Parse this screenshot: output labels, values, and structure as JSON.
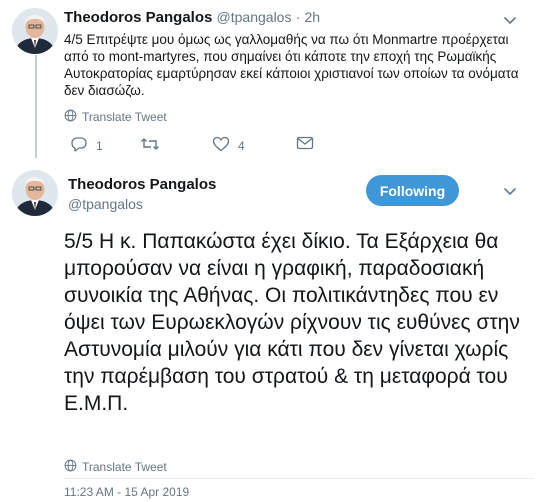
{
  "tweet1": {
    "author_name": "Theodoros Pangalos",
    "handle": "@tpangalos",
    "separator": "·",
    "time": "2h",
    "text": "4/5 Επιτρέψτε μου όμως ως γαλλομαθής να πω ότι Monmartre προέρχεται από το mont-martyres, που σημαίνει ότι κάποτε την εποχή της Ρωμαϊκής Αυτοκρατορίας εμαρτύρησαν εκεί κάποιοι χριστιανοί των οποίων τα ονόματα δεν διασώζω.",
    "translate_label": "Translate Tweet",
    "reply_count": "1",
    "retweet_count": "",
    "like_count": "4"
  },
  "tweet2": {
    "author_name": "Theodoros Pangalos",
    "handle": "@tpangalos",
    "follow_label": "Following",
    "text": "5/5 Η κ. Παπακώστα έχει δίκιο. Τα Εξάρχεια θα μπορούσαν να είναι η γραφική, παραδοσιακή συνοικία της Αθήνας. Οι πολιτικάντηδες που εν όψει των Ευρωεκλογών ρίχνουν τις ευθύνες στην Αστυνομία μιλούν για κάτι που δεν γίνεται χωρίς την παρέμβαση του στρατού & τη μεταφορά του Ε.Μ.Π.",
    "translate_label": "Translate Tweet",
    "timestamp": "11:23 AM - 15 Apr 2019"
  },
  "icons": {
    "reply": "reply-icon",
    "retweet": "retweet-icon",
    "like": "heart-icon",
    "dm": "envelope-icon",
    "translate": "globe-icon",
    "menu": "chevron-down-icon"
  },
  "colors": {
    "accent": "#3f97d8",
    "secondary_text": "#657786",
    "primary_text": "#14171a",
    "thread_line": "#c4cfd6"
  }
}
